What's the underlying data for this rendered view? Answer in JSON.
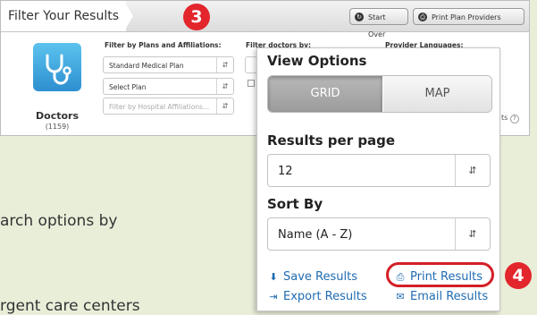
{
  "filter_bar": {
    "title": "Filter Your Results",
    "start_over_label": "Start Over",
    "print_providers_label": "Print Plan Providers"
  },
  "doctors": {
    "label": "Doctors",
    "count": "(1159)"
  },
  "plans": {
    "title": "Filter by Plans and Affiliations:",
    "selects": [
      "Standard Medical Plan",
      "Select Plan"
    ],
    "hospital_placeholder": "Filter by Hospital Affiliations..."
  },
  "doctors_filter": {
    "title": "Filter doctors by:"
  },
  "languages": {
    "title": "Provider Languages:",
    "fragment": "ts"
  },
  "background_text": [
    "arch options by",
    "rgent care centers"
  ],
  "badges": [
    "3",
    "4"
  ],
  "view_options": {
    "title": "View Options",
    "grid_label": "GRID",
    "map_label": "MAP",
    "results_per_page_title": "Results per page",
    "results_per_page_value": "12",
    "sort_by_title": "Sort By",
    "sort_by_value": "Name (A - Z)",
    "save_label": "Save Results",
    "print_label": "Print Results",
    "export_label": "Export Results",
    "email_label": "Email Results"
  },
  "colors": {
    "link": "#1f6bb1",
    "badge": "#e2262c",
    "highlight": "#d42027",
    "page_bg": "#e9eed9"
  }
}
